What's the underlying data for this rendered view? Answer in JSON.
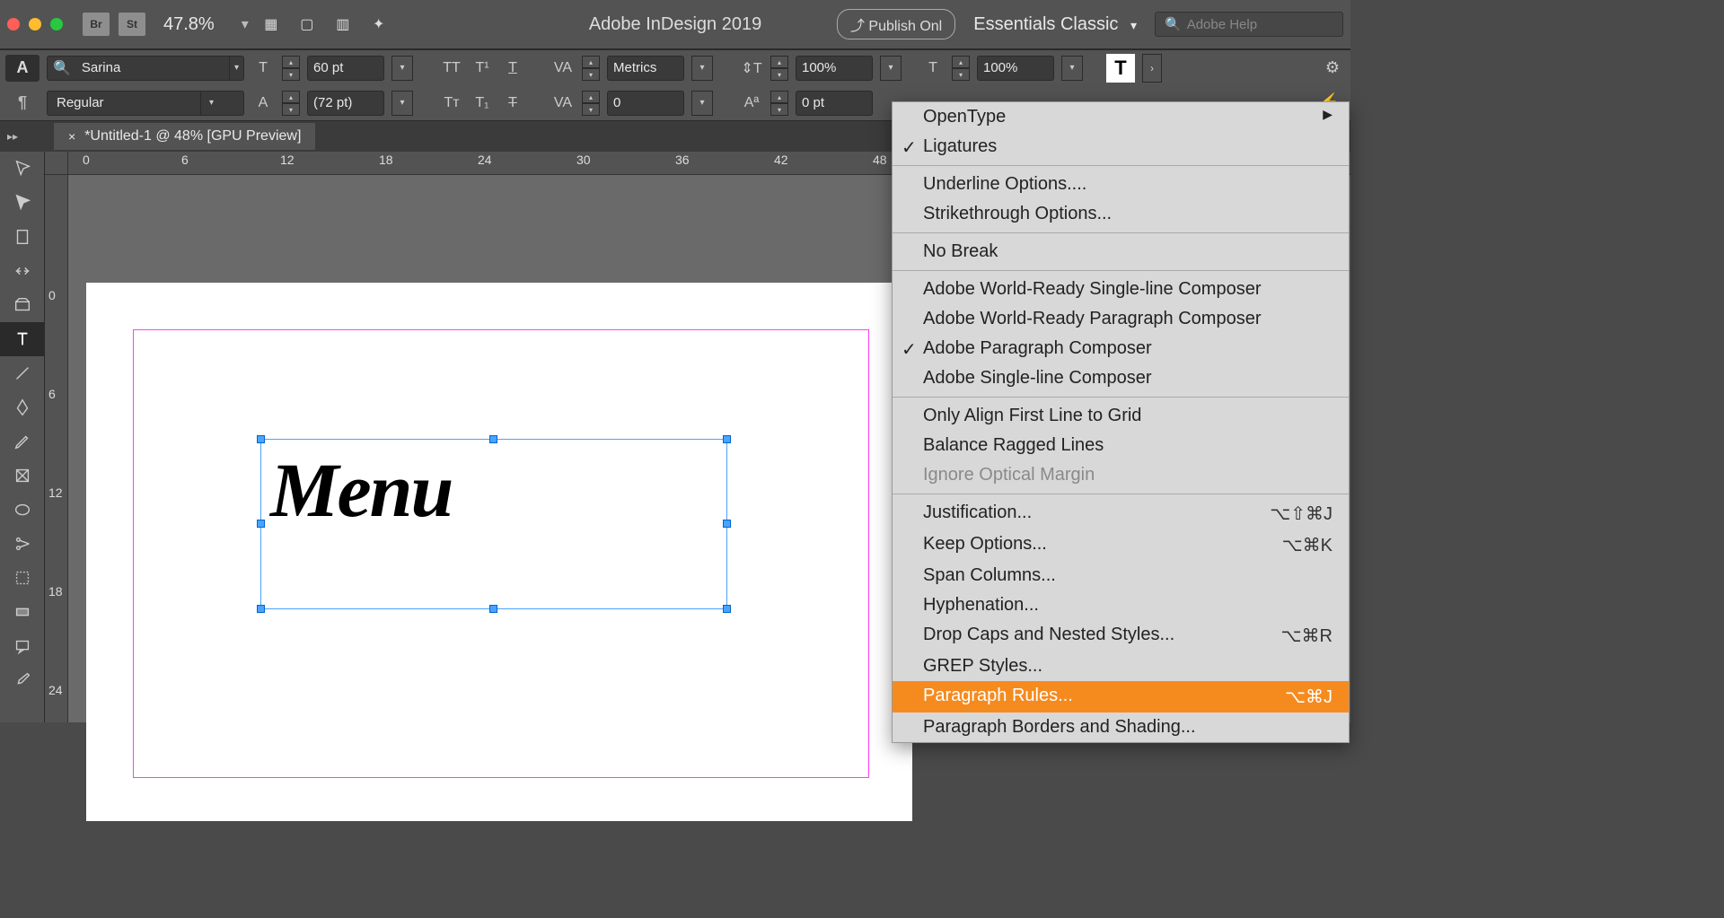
{
  "appbar": {
    "br_label": "Br",
    "st_label": "St",
    "zoom": "47.8%",
    "title": "Adobe InDesign 2019",
    "publish": "Publish Onl",
    "workspace": "Essentials Classic",
    "search_placeholder": "Adobe Help"
  },
  "ctrl": {
    "font": "Sarina",
    "style": "Regular",
    "size": "60 pt",
    "leading": "(72 pt)",
    "kerning": "Metrics",
    "tracking_value": "0",
    "hscale": "100%",
    "vscale": "100%",
    "baseline": "0 pt"
  },
  "tab": {
    "name": "*Untitled-1 @ 48% [GPU Preview]"
  },
  "hruler": [
    "0",
    "6",
    "12",
    "18",
    "24",
    "30",
    "36",
    "42",
    "48"
  ],
  "vruler": [
    "0",
    "6",
    "12",
    "18",
    "24"
  ],
  "canvas_text": "Menu",
  "menu": {
    "items": [
      {
        "label": "OpenType",
        "submenu": true
      },
      {
        "label": "Ligatures",
        "checked": true
      },
      {
        "sep": true
      },
      {
        "label": "Underline Options...."
      },
      {
        "label": "Strikethrough Options..."
      },
      {
        "sep": true
      },
      {
        "label": "No Break"
      },
      {
        "sep": true
      },
      {
        "label": "Adobe World-Ready Single-line Composer"
      },
      {
        "label": "Adobe World-Ready Paragraph Composer"
      },
      {
        "label": "Adobe Paragraph Composer",
        "checked": true
      },
      {
        "label": "Adobe Single-line Composer"
      },
      {
        "sep": true
      },
      {
        "label": "Only Align First Line to Grid"
      },
      {
        "label": "Balance Ragged Lines"
      },
      {
        "label": "Ignore Optical Margin",
        "disabled": true
      },
      {
        "sep": true
      },
      {
        "label": "Justification...",
        "shortcut": "⌥⇧⌘J"
      },
      {
        "label": "Keep Options...",
        "shortcut": "⌥⌘K"
      },
      {
        "label": "Span Columns..."
      },
      {
        "label": "Hyphenation..."
      },
      {
        "label": "Drop Caps and Nested Styles...",
        "shortcut": "⌥⌘R"
      },
      {
        "label": "GREP Styles..."
      },
      {
        "label": "Paragraph Rules...",
        "shortcut": "⌥⌘J",
        "highlight": true
      },
      {
        "label": "Paragraph Borders and Shading..."
      }
    ]
  }
}
